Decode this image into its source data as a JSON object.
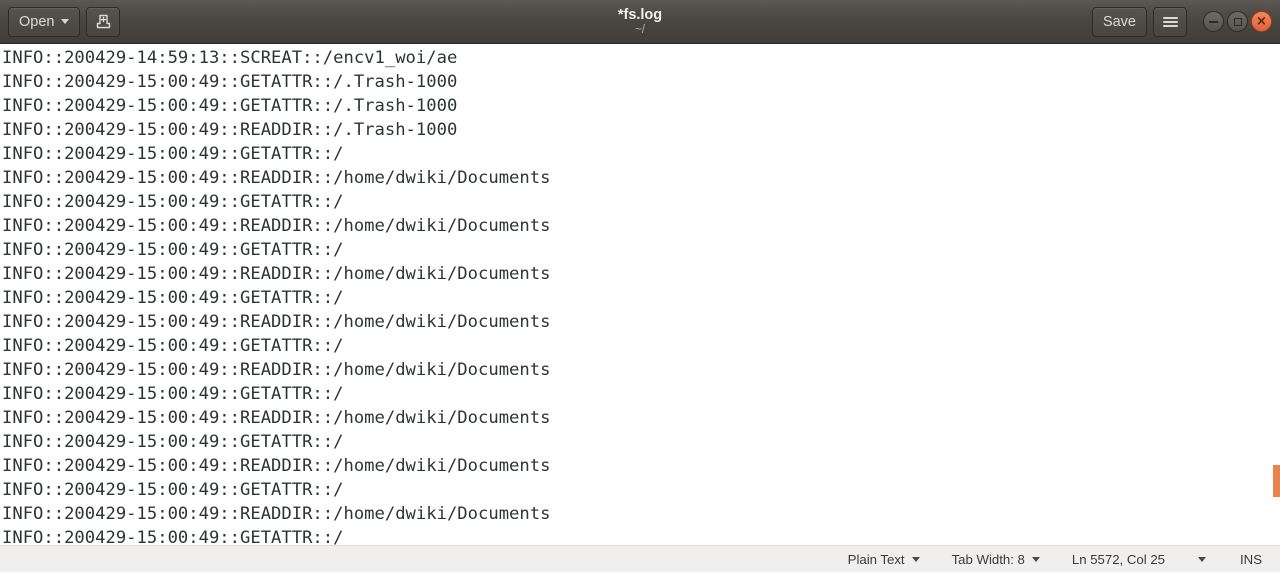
{
  "window": {
    "title": "*fs.log",
    "subtitle": "~/"
  },
  "headerbar": {
    "open_label": "Open",
    "open_caret_icon": "chevron-down-icon",
    "save_as_icon": "save-as-document-icon",
    "save_label": "Save",
    "menu_icon": "hamburger-menu-icon",
    "minimize_icon": "minimize-icon",
    "maximize_icon": "maximize-icon",
    "close_icon": "close-icon",
    "close_glyph": "×"
  },
  "editor": {
    "lines": [
      "INFO::200429-14:59:13::SCREAT::/encv1_woi/ae",
      "INFO::200429-15:00:49::GETATTR::/.Trash-1000",
      "INFO::200429-15:00:49::GETATTR::/.Trash-1000",
      "INFO::200429-15:00:49::READDIR::/.Trash-1000",
      "INFO::200429-15:00:49::GETATTR::/",
      "INFO::200429-15:00:49::READDIR::/home/dwiki/Documents",
      "INFO::200429-15:00:49::GETATTR::/",
      "INFO::200429-15:00:49::READDIR::/home/dwiki/Documents",
      "INFO::200429-15:00:49::GETATTR::/",
      "INFO::200429-15:00:49::READDIR::/home/dwiki/Documents",
      "INFO::200429-15:00:49::GETATTR::/",
      "INFO::200429-15:00:49::READDIR::/home/dwiki/Documents",
      "INFO::200429-15:00:49::GETATTR::/",
      "INFO::200429-15:00:49::READDIR::/home/dwiki/Documents",
      "INFO::200429-15:00:49::GETATTR::/",
      "INFO::200429-15:00:49::READDIR::/home/dwiki/Documents",
      "INFO::200429-15:00:49::GETATTR::/",
      "INFO::200429-15:00:49::READDIR::/home/dwiki/Documents",
      "INFO::200429-15:00:49::GETATTR::/",
      "INFO::200429-15:00:49::READDIR::/home/dwiki/Documents",
      "INFO::200429-15:00:49::GETATTR::/"
    ]
  },
  "statusbar": {
    "language": "Plain Text",
    "tab_width": "Tab Width: 8",
    "cursor_position": "Ln 5572, Col 25",
    "insert_mode": "INS"
  },
  "colors": {
    "headerbar_top": "#5c5853",
    "headerbar_bottom": "#403d39",
    "close_button": "#e2603a",
    "scrollbar_thumb": "#e8854f",
    "editor_text": "#2e3436",
    "statusbar_bg": "#f1efed"
  }
}
